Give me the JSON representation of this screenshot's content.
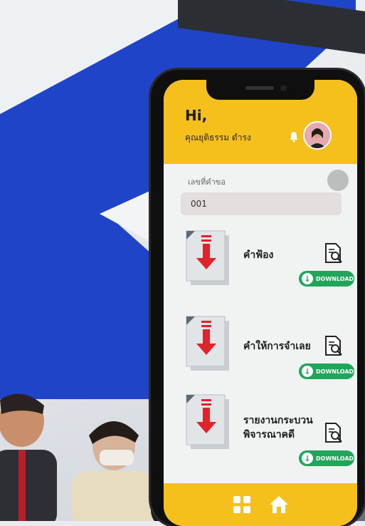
{
  "colors": {
    "header_yellow": "#f5bf1c",
    "download_green": "#1fa65a",
    "download_arrow_red": "#e0232b",
    "wall_blue": "#1f44c8"
  },
  "header": {
    "greeting": "Hi,",
    "user_name": "คุณยุติธรรม ดำรง",
    "bell_icon": "bell-icon",
    "avatar_icon": "avatar"
  },
  "form": {
    "case_number_label": "เลขที่คำขอ",
    "case_number_value": "001"
  },
  "documents": [
    {
      "title": "คำฟ้อง",
      "download_label": "DOWNLOAD"
    },
    {
      "title": "คำให้การจำเลย",
      "download_label": "DOWNLOAD"
    },
    {
      "title": "รายงานกระบวนพิจารณาคดี",
      "download_label": "DOWNLOAD"
    }
  ],
  "bottom_nav": {
    "items": [
      "grid-icon",
      "home-icon"
    ]
  }
}
